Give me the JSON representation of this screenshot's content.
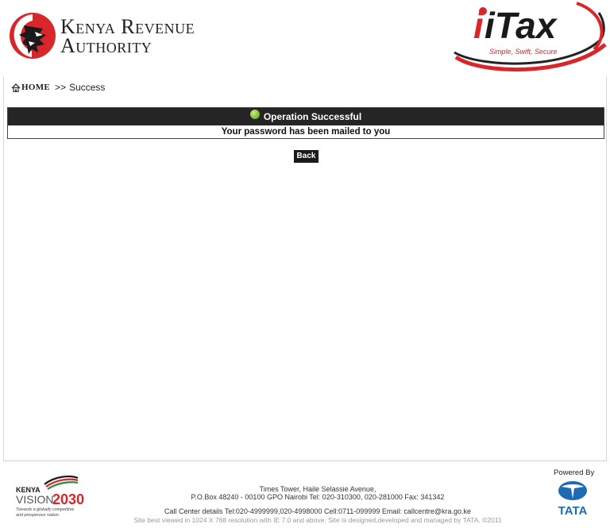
{
  "header": {
    "org_line1": "Kenya Revenue",
    "org_line2": "Authority",
    "itax_text": "iTax",
    "itax_tagline": "Simple, Swift, Secure"
  },
  "breadcrumb": {
    "home": "HOME",
    "separator": ">>",
    "current": "Success"
  },
  "message": {
    "title": "Operation Successful",
    "body": "Your password has been mailed to you"
  },
  "actions": {
    "back_label": "Back"
  },
  "footer": {
    "vision_kenya": "KENYA",
    "vision_word": "VISION",
    "vision_year": "2030",
    "vision_tag1": "Towards a globally competitive",
    "vision_tag2": "and prosperous nation.",
    "address1": "Times Tower, Haile Selassie Avenue,",
    "address2": "P.O.Box 48240 - 00100 GPO Nairobi Tel: 020-310300, 020-281000 Fax: 341342",
    "callcenter": "Call Center details Tel:020-4999999,020-4998000 Cell:0711-099999 Email: callcentre@kra.go.ke",
    "site_note": "Site best viewed in 1024 X 768 resolution with IE 7.0 and above. Site is designed,developed and managed by TATA. ©2011",
    "powered_by": "Powered By",
    "tata_text": "TATA"
  },
  "colors": {
    "kra_red": "#d9262b",
    "bar_dark": "#252525",
    "tata_blue": "#1d6cb3"
  }
}
